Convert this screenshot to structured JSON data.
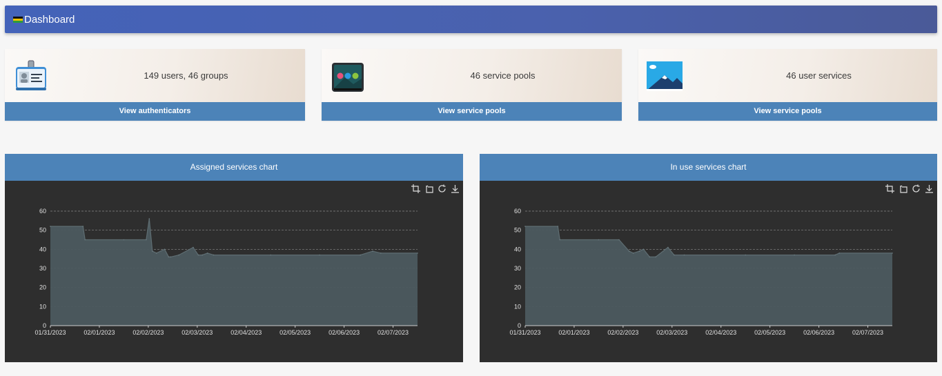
{
  "header": {
    "title": "Dashboard"
  },
  "cards": [
    {
      "summary": "149 users, 46 groups",
      "button": "View authenticators",
      "icon": "id-card-icon"
    },
    {
      "summary": "46 service pools",
      "button": "View service pools",
      "icon": "service-pool-icon"
    },
    {
      "summary": "46 user services",
      "button": "View service pools",
      "icon": "landscape-icon"
    }
  ],
  "charts_ui": {
    "toolbar_icons": [
      "zoom-in-icon",
      "zoom-reset-icon",
      "refresh-icon",
      "download-icon"
    ],
    "series_color": "#4c5a5f",
    "background": "#2e2e2e"
  },
  "chart_data": [
    {
      "type": "area",
      "title": "Assigned services chart",
      "ylim": [
        0,
        60
      ],
      "yticks": [
        0,
        10,
        20,
        30,
        40,
        50,
        60
      ],
      "xlim": [
        "01/31/2023",
        "02/07/2023 12:00"
      ],
      "xticks": [
        "01/31/2023",
        "02/01/2023",
        "02/02/2023",
        "02/03/2023",
        "02/04/2023",
        "02/05/2023",
        "02/06/2023",
        "02/07/2023"
      ],
      "grid": true,
      "x": [
        "01/31/2023 00:00",
        "01/31/2023 16:00",
        "01/31/2023 17:00",
        "02/01/2023 12:00",
        "02/01/2023 23:00",
        "02/02/2023 00:30",
        "02/02/2023 02:00",
        "02/02/2023 04:00",
        "02/02/2023 08:00",
        "02/02/2023 10:00",
        "02/02/2023 11:00",
        "02/02/2023 15:00",
        "02/02/2023 22:00",
        "02/03/2023 00:30",
        "02/03/2023 02:30",
        "02/03/2023 05:00",
        "02/03/2023 08:00",
        "02/04/2023 12:00",
        "02/05/2023 12:00",
        "02/06/2023 08:00",
        "02/06/2023 14:00",
        "02/06/2023 18:00",
        "02/07/2023 12:00"
      ],
      "y": [
        52,
        52,
        45,
        45,
        45,
        56,
        39,
        38,
        40,
        36,
        36,
        37,
        41,
        37,
        37,
        38,
        37,
        37,
        37,
        37,
        39,
        38,
        38
      ]
    },
    {
      "type": "area",
      "title": "In use services chart",
      "ylim": [
        0,
        60
      ],
      "yticks": [
        0,
        10,
        20,
        30,
        40,
        50,
        60
      ],
      "xlim": [
        "01/31/2023",
        "02/07/2023 12:00"
      ],
      "xticks": [
        "01/31/2023",
        "02/01/2023",
        "02/02/2023",
        "02/03/2023",
        "02/04/2023",
        "02/05/2023",
        "02/06/2023",
        "02/07/2023"
      ],
      "grid": true,
      "x": [
        "01/31/2023 00:00",
        "01/31/2023 16:00",
        "01/31/2023 17:00",
        "02/01/2023 12:00",
        "02/01/2023 22:00",
        "02/02/2023 03:00",
        "02/02/2023 05:00",
        "02/02/2023 08:00",
        "02/02/2023 10:00",
        "02/02/2023 13:00",
        "02/02/2023 16:00",
        "02/02/2023 22:00",
        "02/03/2023 01:00",
        "02/03/2023 06:00",
        "02/04/2023 12:00",
        "02/05/2023 12:00",
        "02/06/2023 08:00",
        "02/06/2023 10:00",
        "02/07/2023 12:00"
      ],
      "y": [
        52,
        52,
        45,
        45,
        45,
        39,
        38,
        39,
        40,
        36,
        36,
        41,
        37,
        37,
        37,
        37,
        37,
        38,
        38
      ]
    }
  ]
}
